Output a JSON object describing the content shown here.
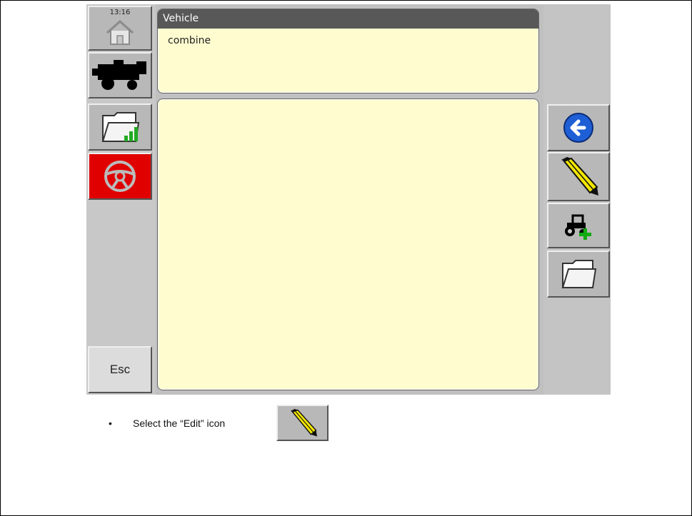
{
  "clock": "13:16",
  "vehicle_panel": {
    "header": "Vehicle",
    "value": "combine"
  },
  "esc_label": "Esc",
  "left_buttons": [
    "home-icon",
    "combine-icon",
    "folder-signal-icon",
    "steering-wheel-icon"
  ],
  "right_buttons": [
    "back-arrow-icon",
    "pencil-edit-icon",
    "tractor-add-icon",
    "folder-icon"
  ],
  "instruction": {
    "bullet": "•",
    "text": "Select the “Edit” icon",
    "icon": "pencil-edit-icon"
  },
  "colors": {
    "panel_bg": "#fffdd0",
    "header_bg": "#585858",
    "alert_red": "#e00000",
    "back_blue": "#1f5fd6",
    "pencil_yellow": "#f2e600"
  }
}
